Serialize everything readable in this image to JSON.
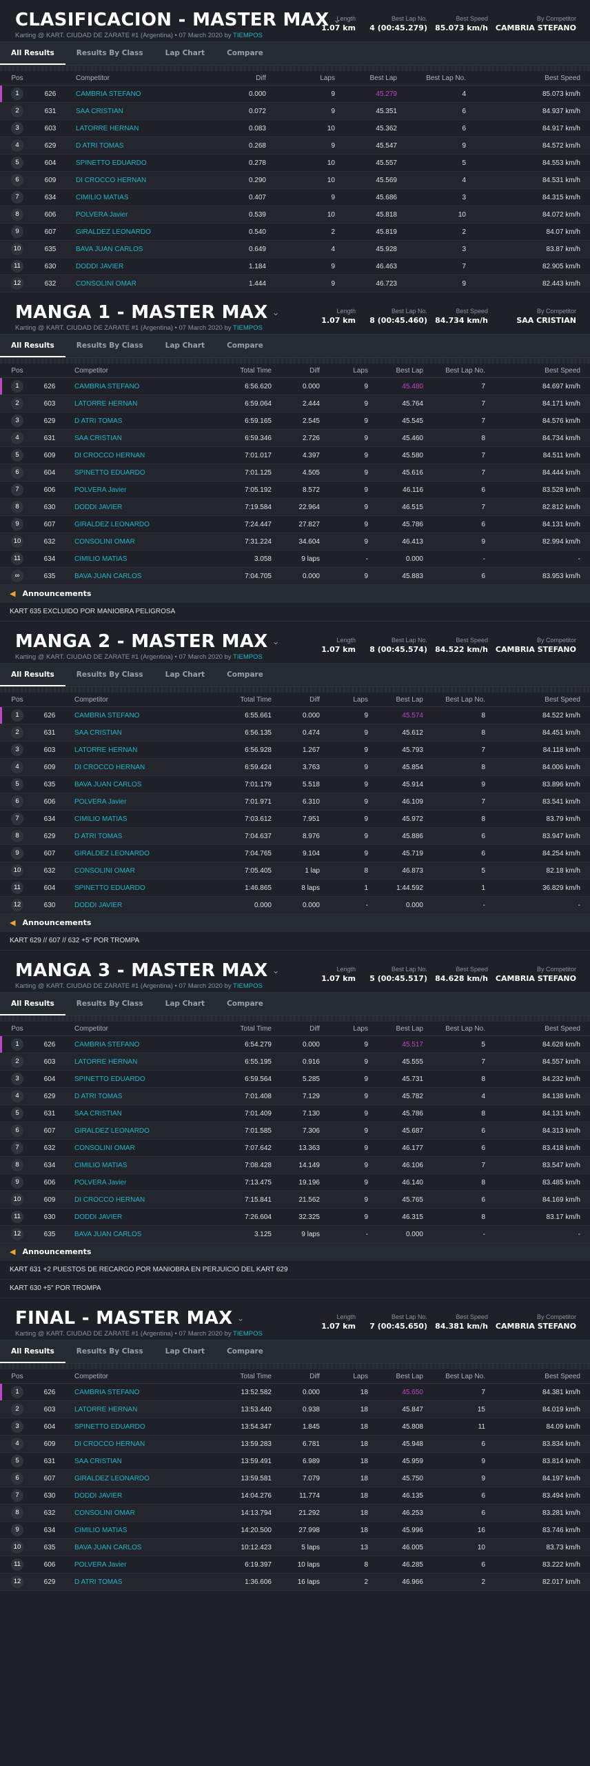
{
  "tabs": [
    "All Results",
    "Results By Class",
    "Lap Chart",
    "Compare"
  ],
  "subtitle_prefix": "Karting @ KART. CIUDAD DE ZARATE #1 (Argentina) • 07 March 2020 by",
  "subtitle_link": "TIEMPOS",
  "stat_labels": {
    "length": "Length",
    "best_lap_no": "Best Lap No.",
    "best_speed": "Best Speed",
    "by_competitor": "By Competitor"
  },
  "ann_title": "Announcements",
  "sessions": [
    {
      "title": "CLASIFICACION - MASTER MAX",
      "length": "1.07 km",
      "best_lap_no": "4 (00:45.279)",
      "best_speed": "85.073 km/h",
      "by_competitor": "CAMBRIA STEFANO",
      "qual": true,
      "headers": [
        "Pos",
        "",
        "Competitor",
        "Diff",
        "Laps",
        "Best Lap",
        "Best Lap No.",
        "Best Speed"
      ],
      "rows": [
        [
          "1",
          "626",
          "CAMBRIA STEFANO",
          "0.000",
          "9",
          "45.279",
          "4",
          "85.073 km/h"
        ],
        [
          "2",
          "631",
          "SAA CRISTIAN",
          "0.072",
          "9",
          "45.351",
          "6",
          "84.937 km/h"
        ],
        [
          "3",
          "603",
          "LATORRE HERNAN",
          "0.083",
          "10",
          "45.362",
          "6",
          "84.917 km/h"
        ],
        [
          "4",
          "629",
          "D ATRI TOMAS",
          "0.268",
          "9",
          "45.547",
          "9",
          "84.572 km/h"
        ],
        [
          "5",
          "604",
          "SPINETTO EDUARDO",
          "0.278",
          "10",
          "45.557",
          "5",
          "84.553 km/h"
        ],
        [
          "6",
          "609",
          "DI CROCCO HERNAN",
          "0.290",
          "10",
          "45.569",
          "4",
          "84.531 km/h"
        ],
        [
          "7",
          "634",
          "CIMILIO MATIAS",
          "0.407",
          "9",
          "45.686",
          "3",
          "84.315 km/h"
        ],
        [
          "8",
          "606",
          "POLVERA Javier",
          "0.539",
          "10",
          "45.818",
          "10",
          "84.072 km/h"
        ],
        [
          "9",
          "607",
          "GIRALDEZ LEONARDO",
          "0.540",
          "2",
          "45.819",
          "2",
          "84.07 km/h"
        ],
        [
          "10",
          "635",
          "BAVA JUAN CARLOS",
          "0.649",
          "4",
          "45.928",
          "3",
          "83.87 km/h"
        ],
        [
          "11",
          "630",
          "DODDI JAVIER",
          "1.184",
          "9",
          "46.463",
          "7",
          "82.905 km/h"
        ],
        [
          "12",
          "632",
          "CONSOLINI OMAR",
          "1.444",
          "9",
          "46.723",
          "9",
          "82.443 km/h"
        ]
      ],
      "announcements": []
    },
    {
      "title": "MANGA 1 - MASTER MAX",
      "length": "1.07 km",
      "best_lap_no": "8 (00:45.460)",
      "best_speed": "84.734 km/h",
      "by_competitor": "SAA CRISTIAN",
      "qual": false,
      "headers": [
        "Pos",
        "",
        "Competitor",
        "Total Time",
        "Diff",
        "Laps",
        "Best Lap",
        "Best Lap No.",
        "Best Speed"
      ],
      "rows": [
        [
          "1",
          "626",
          "CAMBRIA STEFANO",
          "6:56.620",
          "0.000",
          "9",
          "45.480",
          "7",
          "84.697 km/h"
        ],
        [
          "2",
          "603",
          "LATORRE HERNAN",
          "6:59.064",
          "2.444",
          "9",
          "45.764",
          "7",
          "84.171 km/h"
        ],
        [
          "3",
          "629",
          "D ATRI TOMAS",
          "6:59.165",
          "2.545",
          "9",
          "45.545",
          "7",
          "84.576 km/h"
        ],
        [
          "4",
          "631",
          "SAA CRISTIAN",
          "6:59.346",
          "2.726",
          "9",
          "45.460",
          "8",
          "84.734 km/h"
        ],
        [
          "5",
          "609",
          "DI CROCCO HERNAN",
          "7:01.017",
          "4.397",
          "9",
          "45.580",
          "7",
          "84.511 km/h"
        ],
        [
          "6",
          "604",
          "SPINETTO EDUARDO",
          "7:01.125",
          "4.505",
          "9",
          "45.616",
          "7",
          "84.444 km/h"
        ],
        [
          "7",
          "606",
          "POLVERA Javier",
          "7:05.192",
          "8.572",
          "9",
          "46.116",
          "6",
          "83.528 km/h"
        ],
        [
          "8",
          "630",
          "DODDI JAVIER",
          "7:19.584",
          "22.964",
          "9",
          "46.515",
          "7",
          "82.812 km/h"
        ],
        [
          "9",
          "607",
          "GIRALDEZ LEONARDO",
          "7:24.447",
          "27.827",
          "9",
          "45.786",
          "6",
          "84.131 km/h"
        ],
        [
          "10",
          "632",
          "CONSOLINI OMAR",
          "7:31.224",
          "34.604",
          "9",
          "46.413",
          "9",
          "82.994 km/h"
        ],
        [
          "11",
          "634",
          "CIMILIO MATIAS",
          "3.058",
          "9 laps",
          "-",
          "0.000",
          "-",
          "-"
        ],
        [
          "∞",
          "635",
          "BAVA JUAN CARLOS",
          "7:04.705",
          "0.000",
          "9",
          "45.883",
          "6",
          "83.953 km/h"
        ]
      ],
      "announcements": [
        "KART 635 EXCLUIDO POR MANIOBRA PELIGROSA"
      ]
    },
    {
      "title": "MANGA 2 - MASTER MAX",
      "length": "1.07 km",
      "best_lap_no": "8 (00:45.574)",
      "best_speed": "84.522 km/h",
      "by_competitor": "CAMBRIA STEFANO",
      "qual": false,
      "headers": [
        "Pos",
        "",
        "Competitor",
        "Total Time",
        "Diff",
        "Laps",
        "Best Lap",
        "Best Lap No.",
        "Best Speed"
      ],
      "rows": [
        [
          "1",
          "626",
          "CAMBRIA STEFANO",
          "6:55.661",
          "0.000",
          "9",
          "45.574",
          "8",
          "84.522 km/h"
        ],
        [
          "2",
          "631",
          "SAA CRISTIAN",
          "6:56.135",
          "0.474",
          "9",
          "45.612",
          "8",
          "84.451 km/h"
        ],
        [
          "3",
          "603",
          "LATORRE HERNAN",
          "6:56.928",
          "1.267",
          "9",
          "45.793",
          "7",
          "84.118 km/h"
        ],
        [
          "4",
          "609",
          "DI CROCCO HERNAN",
          "6:59.424",
          "3.763",
          "9",
          "45.854",
          "8",
          "84.006 km/h"
        ],
        [
          "5",
          "635",
          "BAVA JUAN CARLOS",
          "7:01.179",
          "5.518",
          "9",
          "45.914",
          "9",
          "83.896 km/h"
        ],
        [
          "6",
          "606",
          "POLVERA Javier",
          "7:01.971",
          "6.310",
          "9",
          "46.109",
          "7",
          "83.541 km/h"
        ],
        [
          "7",
          "634",
          "CIMILIO MATIAS",
          "7:03.612",
          "7.951",
          "9",
          "45.972",
          "8",
          "83.79 km/h"
        ],
        [
          "8",
          "629",
          "D ATRI TOMAS",
          "7:04.637",
          "8.976",
          "9",
          "45.886",
          "6",
          "83.947 km/h"
        ],
        [
          "9",
          "607",
          "GIRALDEZ LEONARDO",
          "7:04.765",
          "9.104",
          "9",
          "45.719",
          "6",
          "84.254 km/h"
        ],
        [
          "10",
          "632",
          "CONSOLINI OMAR",
          "7:05.405",
          "1 lap",
          "8",
          "46.873",
          "5",
          "82.18 km/h"
        ],
        [
          "11",
          "604",
          "SPINETTO EDUARDO",
          "1:46.865",
          "8 laps",
          "1",
          "1:44.592",
          "1",
          "36.829 km/h"
        ],
        [
          "12",
          "630",
          "DODDI JAVIER",
          "0.000",
          "0.000",
          "-",
          "0.000",
          "-",
          "-"
        ]
      ],
      "announcements": [
        "KART 629 // 607 // 632 +5\" POR TROMPA"
      ]
    },
    {
      "title": "MANGA 3 - MASTER MAX",
      "length": "1.07 km",
      "best_lap_no": "5 (00:45.517)",
      "best_speed": "84.628 km/h",
      "by_competitor": "CAMBRIA STEFANO",
      "qual": false,
      "headers": [
        "Pos",
        "",
        "Competitor",
        "Total Time",
        "Diff",
        "Laps",
        "Best Lap",
        "Best Lap No.",
        "Best Speed"
      ],
      "rows": [
        [
          "1",
          "626",
          "CAMBRIA STEFANO",
          "6:54.279",
          "0.000",
          "9",
          "45.517",
          "5",
          "84.628 km/h"
        ],
        [
          "2",
          "603",
          "LATORRE HERNAN",
          "6:55.195",
          "0.916",
          "9",
          "45.555",
          "7",
          "84.557 km/h"
        ],
        [
          "3",
          "604",
          "SPINETTO EDUARDO",
          "6:59.564",
          "5.285",
          "9",
          "45.731",
          "8",
          "84.232 km/h"
        ],
        [
          "4",
          "629",
          "D ATRI TOMAS",
          "7:01.408",
          "7.129",
          "9",
          "45.782",
          "4",
          "84.138 km/h"
        ],
        [
          "5",
          "631",
          "SAA CRISTIAN",
          "7:01.409",
          "7.130",
          "9",
          "45.786",
          "8",
          "84.131 km/h"
        ],
        [
          "6",
          "607",
          "GIRALDEZ LEONARDO",
          "7:01.585",
          "7.306",
          "9",
          "45.687",
          "6",
          "84.313 km/h"
        ],
        [
          "7",
          "632",
          "CONSOLINI OMAR",
          "7:07.642",
          "13.363",
          "9",
          "46.177",
          "6",
          "83.418 km/h"
        ],
        [
          "8",
          "634",
          "CIMILIO MATIAS",
          "7:08.428",
          "14.149",
          "9",
          "46.106",
          "7",
          "83.547 km/h"
        ],
        [
          "9",
          "606",
          "POLVERA Javier",
          "7:13.475",
          "19.196",
          "9",
          "46.140",
          "8",
          "83.485 km/h"
        ],
        [
          "10",
          "609",
          "DI CROCCO HERNAN",
          "7:15.841",
          "21.562",
          "9",
          "45.765",
          "6",
          "84.169 km/h"
        ],
        [
          "11",
          "630",
          "DODDI JAVIER",
          "7:26.604",
          "32.325",
          "9",
          "46.315",
          "8",
          "83.17 km/h"
        ],
        [
          "12",
          "635",
          "BAVA JUAN CARLOS",
          "3.125",
          "9 laps",
          "-",
          "0.000",
          "-",
          "-"
        ]
      ],
      "announcements": [
        "KART 631 +2 PUESTOS DE RECARGO POR MANIOBRA EN PERJUICIO DEL KART 629",
        "KART 630 +5\" POR TROMPA"
      ]
    },
    {
      "title": "FINAL - MASTER MAX",
      "length": "1.07 km",
      "best_lap_no": "7 (00:45.650)",
      "best_speed": "84.381 km/h",
      "by_competitor": "CAMBRIA STEFANO",
      "qual": false,
      "headers": [
        "Pos",
        "",
        "Competitor",
        "Total Time",
        "Diff",
        "Laps",
        "Best Lap",
        "Best Lap No.",
        "Best Speed"
      ],
      "rows": [
        [
          "1",
          "626",
          "CAMBRIA STEFANO",
          "13:52.582",
          "0.000",
          "18",
          "45.650",
          "7",
          "84.381 km/h"
        ],
        [
          "2",
          "603",
          "LATORRE HERNAN",
          "13:53.440",
          "0.938",
          "18",
          "45.847",
          "15",
          "84.019 km/h"
        ],
        [
          "3",
          "604",
          "SPINETTO EDUARDO",
          "13:54.347",
          "1.845",
          "18",
          "45.808",
          "11",
          "84.09 km/h"
        ],
        [
          "4",
          "609",
          "DI CROCCO HERNAN",
          "13:59.283",
          "6.781",
          "18",
          "45.948",
          "6",
          "83.834 km/h"
        ],
        [
          "5",
          "631",
          "SAA CRISTIAN",
          "13:59.491",
          "6.989",
          "18",
          "45.959",
          "9",
          "83.814 km/h"
        ],
        [
          "6",
          "607",
          "GIRALDEZ LEONARDO",
          "13:59.581",
          "7.079",
          "18",
          "45.750",
          "9",
          "84.197 km/h"
        ],
        [
          "7",
          "630",
          "DODDI JAVIER",
          "14:04.276",
          "11.774",
          "18",
          "46.135",
          "6",
          "83.494 km/h"
        ],
        [
          "8",
          "632",
          "CONSOLINI OMAR",
          "14:13.794",
          "21.292",
          "18",
          "46.253",
          "6",
          "83.281 km/h"
        ],
        [
          "9",
          "634",
          "CIMILIO MATIAS",
          "14:20.500",
          "27.998",
          "18",
          "45.996",
          "16",
          "83.746 km/h"
        ],
        [
          "10",
          "635",
          "BAVA JUAN CARLOS",
          "10:12.423",
          "5 laps",
          "13",
          "46.005",
          "10",
          "83.73 km/h"
        ],
        [
          "11",
          "606",
          "POLVERA Javier",
          "6:19.397",
          "10 laps",
          "8",
          "46.285",
          "6",
          "83.222 km/h"
        ],
        [
          "12",
          "629",
          "D ATRI TOMAS",
          "1:36.606",
          "16 laps",
          "2",
          "46.966",
          "2",
          "82.017 km/h"
        ]
      ],
      "announcements": []
    }
  ]
}
